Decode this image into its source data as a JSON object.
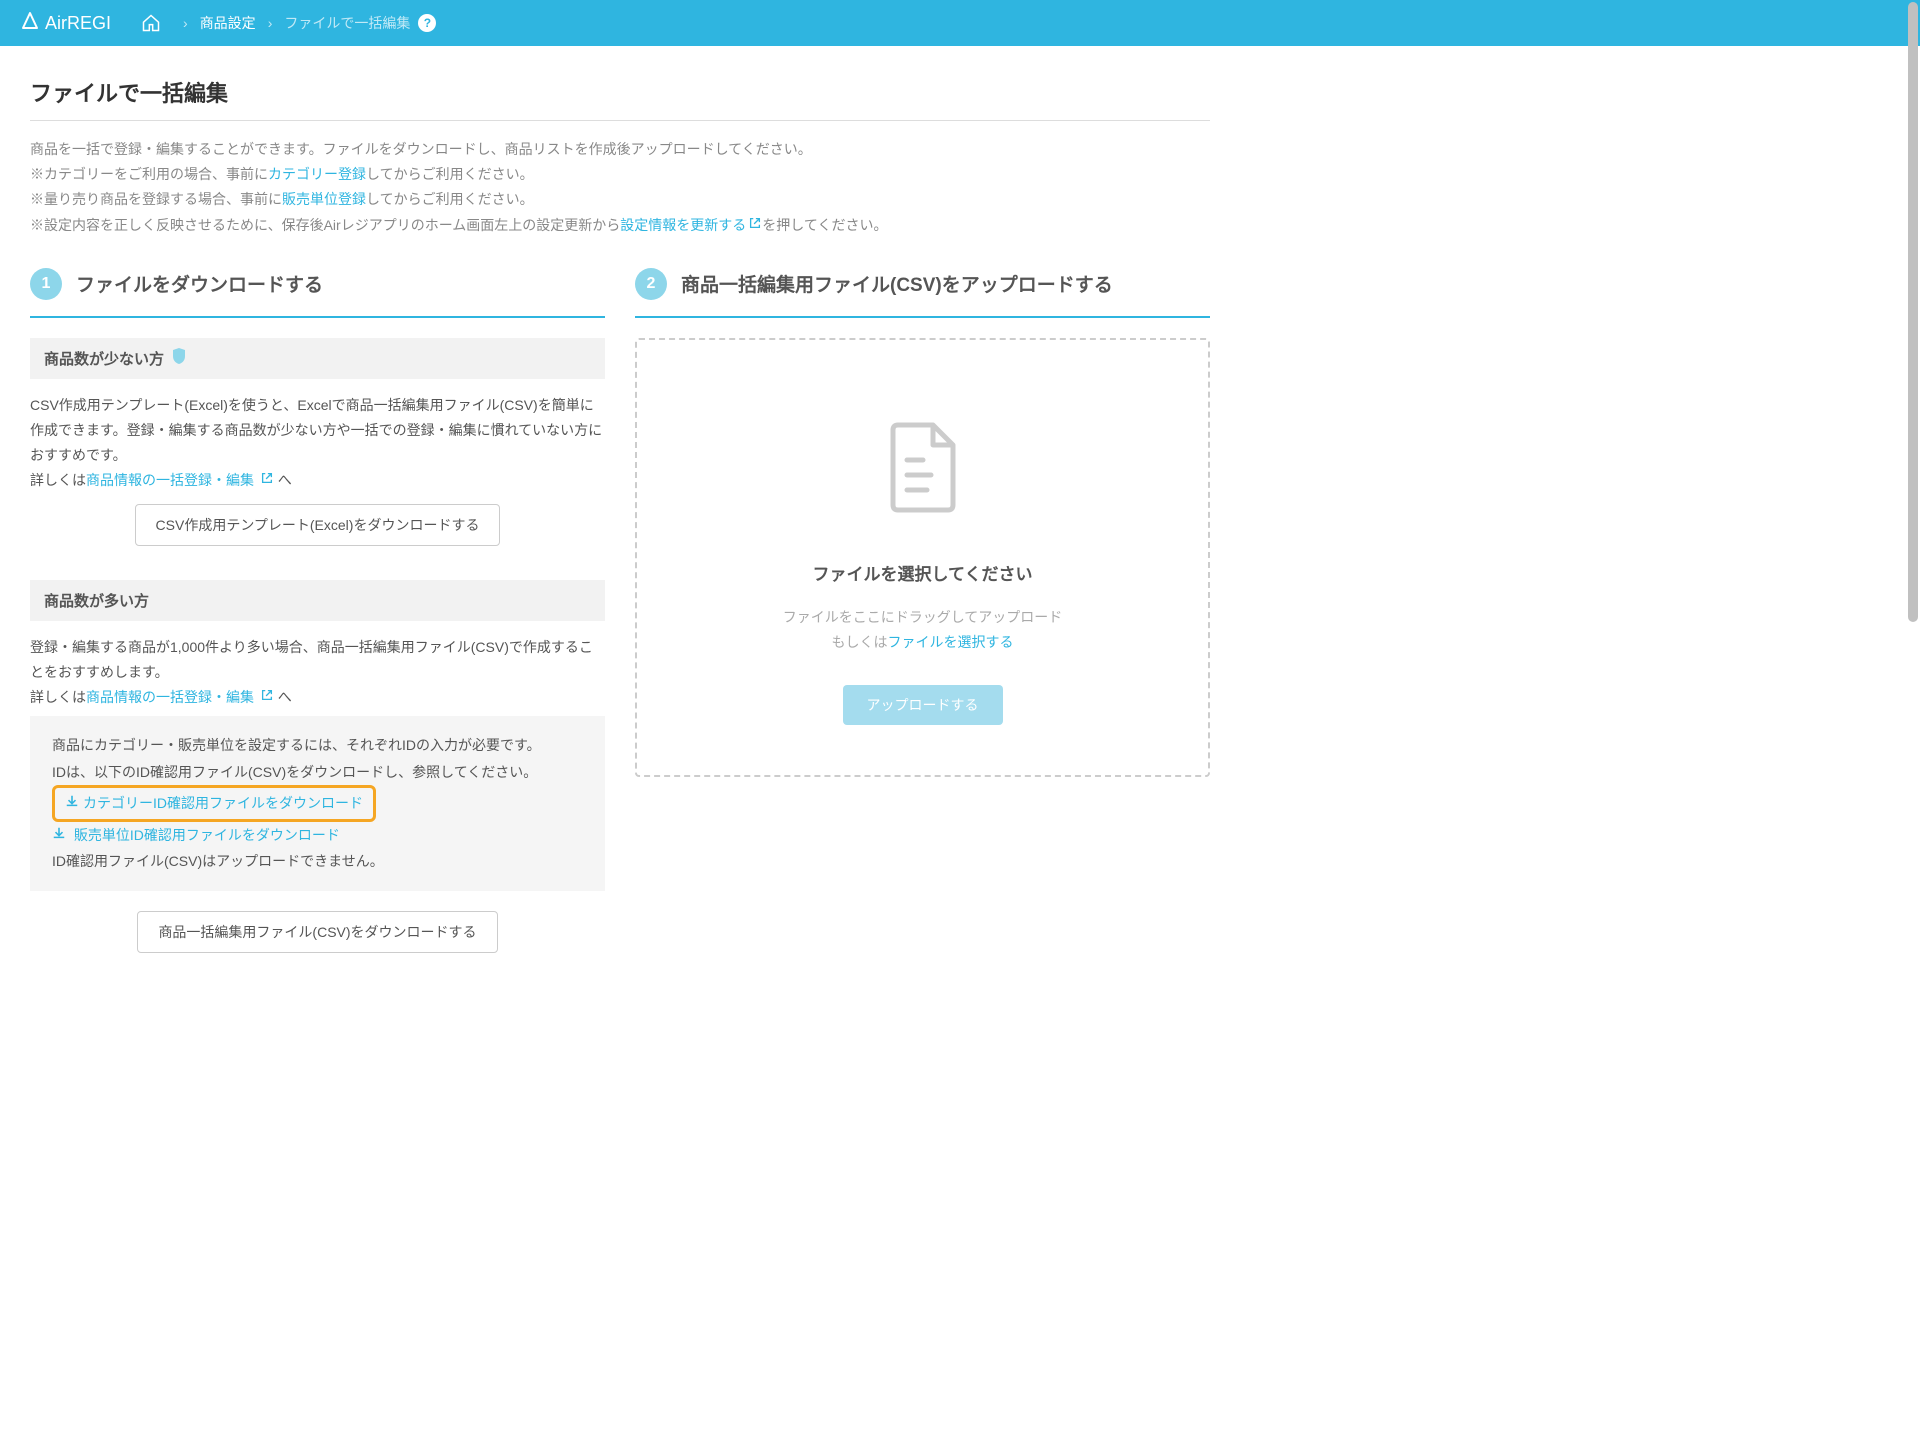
{
  "header": {
    "logo": "AirREGI",
    "breadcrumb": {
      "item1": "商品設定",
      "current": "ファイルで一括編集"
    }
  },
  "page": {
    "title": "ファイルで一括編集",
    "intro": {
      "line1": "商品を一括で登録・編集することができます。ファイルをダウンロードし、商品リストを作成後アップロードしてください。",
      "line2_pre": "※カテゴリーをご利用の場合、事前に",
      "line2_link": "カテゴリー登録",
      "line2_post": "してからご利用ください。",
      "line3_pre": "※量り売り商品を登録する場合、事前に",
      "line3_link": "販売単位登録",
      "line3_post": "してからご利用ください。",
      "line4_pre": "※設定内容を正しく反映させるために、保存後Airレジアプリのホーム画面左上の設定更新から",
      "line4_link": "設定情報を更新する",
      "line4_post": "を押してください。"
    }
  },
  "step1": {
    "number": "1",
    "title": "ファイルをダウンロードする",
    "section_a": {
      "heading": "商品数が少ない方",
      "body": "CSV作成用テンプレート(Excel)を使うと、Excelで商品一括編集用ファイル(CSV)を簡単に作成できます。登録・編集する商品数が少ない方や一括での登録・編集に慣れていない方におすすめです。",
      "link_pre": "詳しくは",
      "link": "商品情報の一括登録・編集",
      "link_post": " へ",
      "button": "CSV作成用テンプレート(Excel)をダウンロードする"
    },
    "section_b": {
      "heading": "商品数が多い方",
      "body": "登録・編集する商品が1,000件より多い場合、商品一括編集用ファイル(CSV)で作成することをおすすめします。",
      "link_pre": "詳しくは",
      "link": "商品情報の一括登録・編集",
      "link_post": " へ",
      "info_line1": "商品にカテゴリー・販売単位を設定するには、それぞれIDの入力が必要です。",
      "info_line2": "IDは、以下のID確認用ファイル(CSV)をダウンロードし、参照してください。",
      "info_link1": "カテゴリーID確認用ファイルをダウンロード",
      "info_link2": "販売単位ID確認用ファイルをダウンロード",
      "info_line3": "ID確認用ファイル(CSV)はアップロードできません。",
      "button": "商品一括編集用ファイル(CSV)をダウンロードする"
    }
  },
  "step2": {
    "number": "2",
    "title": "商品一括編集用ファイル(CSV)をアップロードする",
    "upload": {
      "title": "ファイルを選択してください",
      "sub1": "ファイルをここにドラッグしてアップロード",
      "sub2_pre": "もしくは",
      "sub2_link": "ファイルを選択する",
      "button": "アップロードする"
    }
  }
}
